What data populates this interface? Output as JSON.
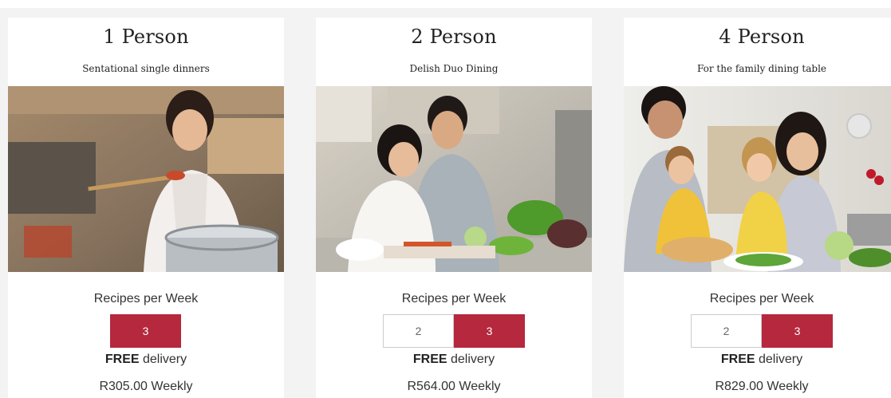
{
  "plans": [
    {
      "title": "1 Person",
      "subtitle": "Sentational single dinners",
      "photo": "woman-tasting-sauce-in-kitchen",
      "recipes_label": "Recipes per Week",
      "options": [
        "3"
      ],
      "selected": "3",
      "delivery_bold": "FREE",
      "delivery_rest": "delivery",
      "price": "R305.00 Weekly"
    },
    {
      "title": "2 Person",
      "subtitle": "Delish Duo Dining",
      "photo": "couple-cooking-together",
      "recipes_label": "Recipes per Week",
      "options": [
        "2",
        "3"
      ],
      "selected": "3",
      "delivery_bold": "FREE",
      "delivery_rest": "delivery",
      "price": "R564.00 Weekly"
    },
    {
      "title": "4 Person",
      "subtitle": "For the family dining table",
      "photo": "family-preparing-food",
      "recipes_label": "Recipes per Week",
      "options": [
        "2",
        "3"
      ],
      "selected": "3",
      "delivery_bold": "FREE",
      "delivery_rest": "delivery",
      "price": "R829.00 Weekly"
    }
  ],
  "colors": {
    "accent": "#b5283d",
    "page_bg": "#f3f3f3",
    "card_bg": "#ffffff",
    "text": "#333333"
  }
}
